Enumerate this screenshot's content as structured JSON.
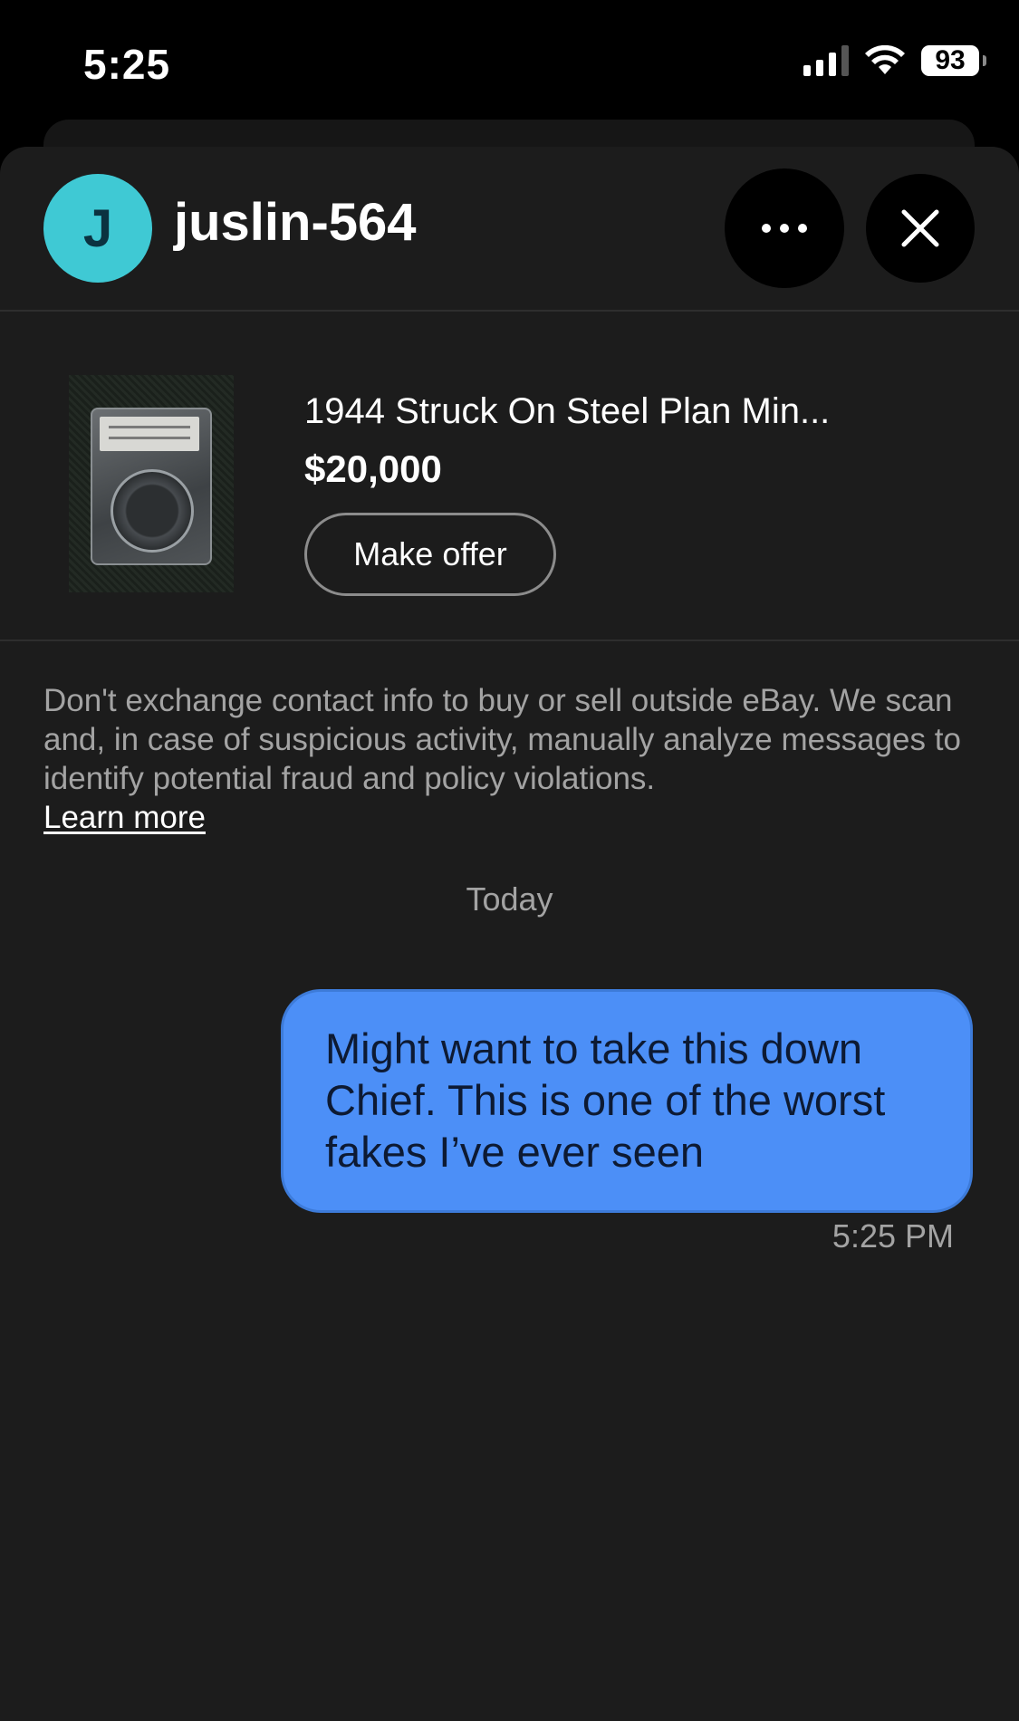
{
  "status_bar": {
    "time": "5:25",
    "battery": "93",
    "icons": [
      "cellular-signal-icon",
      "wifi-icon",
      "battery-icon"
    ]
  },
  "header": {
    "avatar_initial": "J",
    "avatar_color": "#3fc9d4",
    "username": "juslin-564",
    "more_icon": "more-horizontal-icon",
    "close_icon": "close-icon"
  },
  "listing": {
    "title": "1944 Struck On Steel Plan Min...",
    "price": "$20,000",
    "make_offer_label": "Make offer"
  },
  "disclaimer": {
    "text": "Don't exchange contact info to buy or sell outside eBay. We scan and, in case of suspicious activity, manually analyze messages to identify potential fraud and policy violations.",
    "link_label": "Learn more"
  },
  "conversation": {
    "date_separator": "Today",
    "messages": [
      {
        "text": "Might want to take this down Chief. This is one of the worst fakes I’ve ever seen",
        "time": "5:25 PM",
        "bubble_color": "#4c8ff7"
      }
    ]
  }
}
